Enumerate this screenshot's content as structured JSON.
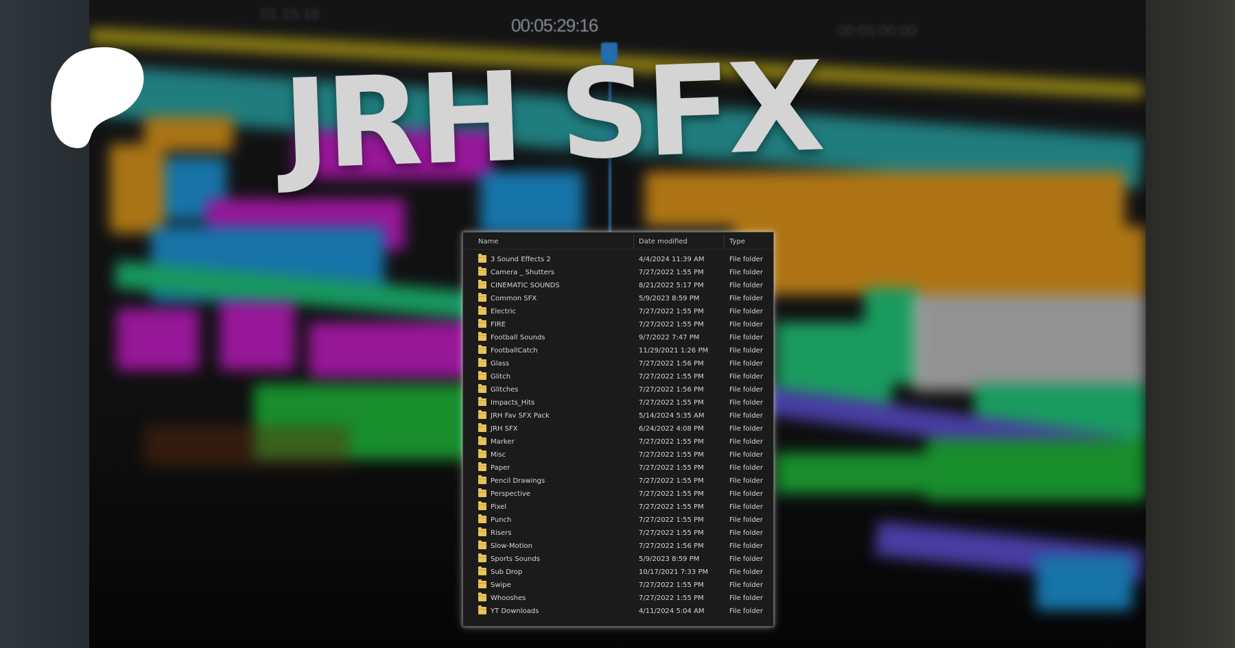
{
  "title": "JRH SFX",
  "background": {
    "timecode": "00:05:29:16",
    "blurred_labels": [
      "01:15:18",
      "00:05:00:00"
    ]
  },
  "logo": {
    "icon": "patreon-logo-icon"
  },
  "explorer": {
    "columns": {
      "name": "Name",
      "date": "Date modified",
      "type": "Type"
    },
    "rows": [
      {
        "name": "3 Sound Effects 2",
        "date": "4/4/2024 11:39 AM",
        "type": "File folder"
      },
      {
        "name": "Camera _ Shutters",
        "date": "7/27/2022 1:55 PM",
        "type": "File folder"
      },
      {
        "name": "CINEMATIC SOUNDS",
        "date": "8/21/2022 5:17 PM",
        "type": "File folder"
      },
      {
        "name": "Common SFX",
        "date": "5/9/2023 8:59 PM",
        "type": "File folder"
      },
      {
        "name": "Electric",
        "date": "7/27/2022 1:55 PM",
        "type": "File folder"
      },
      {
        "name": "FIRE",
        "date": "7/27/2022 1:55 PM",
        "type": "File folder"
      },
      {
        "name": "Football Sounds",
        "date": "9/7/2022 7:47 PM",
        "type": "File folder"
      },
      {
        "name": "FootballCatch",
        "date": "11/29/2021 1:26 PM",
        "type": "File folder"
      },
      {
        "name": "Glass",
        "date": "7/27/2022 1:56 PM",
        "type": "File folder"
      },
      {
        "name": "Glitch",
        "date": "7/27/2022 1:55 PM",
        "type": "File folder"
      },
      {
        "name": "Glitches",
        "date": "7/27/2022 1:56 PM",
        "type": "File folder"
      },
      {
        "name": "Impacts_Hits",
        "date": "7/27/2022 1:55 PM",
        "type": "File folder"
      },
      {
        "name": "JRH Fav SFX Pack",
        "date": "5/14/2024 5:35 AM",
        "type": "File folder"
      },
      {
        "name": "JRH SFX",
        "date": "6/24/2022 4:08 PM",
        "type": "File folder"
      },
      {
        "name": "Marker",
        "date": "7/27/2022 1:55 PM",
        "type": "File folder"
      },
      {
        "name": "Misc",
        "date": "7/27/2022 1:55 PM",
        "type": "File folder"
      },
      {
        "name": "Paper",
        "date": "7/27/2022 1:55 PM",
        "type": "File folder"
      },
      {
        "name": "Pencil Drawings",
        "date": "7/27/2022 1:55 PM",
        "type": "File folder"
      },
      {
        "name": "Perspective",
        "date": "7/27/2022 1:55 PM",
        "type": "File folder"
      },
      {
        "name": "Pixel",
        "date": "7/27/2022 1:55 PM",
        "type": "File folder"
      },
      {
        "name": "Punch",
        "date": "7/27/2022 1:55 PM",
        "type": "File folder"
      },
      {
        "name": "Risers",
        "date": "7/27/2022 1:55 PM",
        "type": "File folder"
      },
      {
        "name": "Slow-Motion",
        "date": "7/27/2022 1:56 PM",
        "type": "File folder"
      },
      {
        "name": "Sports Sounds",
        "date": "5/9/2023 8:59 PM",
        "type": "File folder"
      },
      {
        "name": "Sub Drop",
        "date": "10/17/2021 7:33 PM",
        "type": "File folder"
      },
      {
        "name": "Swipe",
        "date": "7/27/2022 1:55 PM",
        "type": "File folder"
      },
      {
        "name": "Whooshes",
        "date": "7/27/2022 1:55 PM",
        "type": "File folder"
      },
      {
        "name": "YT Downloads",
        "date": "4/11/2024 5:04 AM",
        "type": "File folder"
      }
    ]
  },
  "colors": {
    "folder": "#e8c35a",
    "track_yellow": "#d8c21a",
    "track_teal": "#2aa6a6",
    "track_magenta": "#c81fc8",
    "track_orange": "#e69a1c",
    "track_green": "#24c872",
    "track_blue": "#1f9be0",
    "track_purple": "#6e4fd0"
  }
}
